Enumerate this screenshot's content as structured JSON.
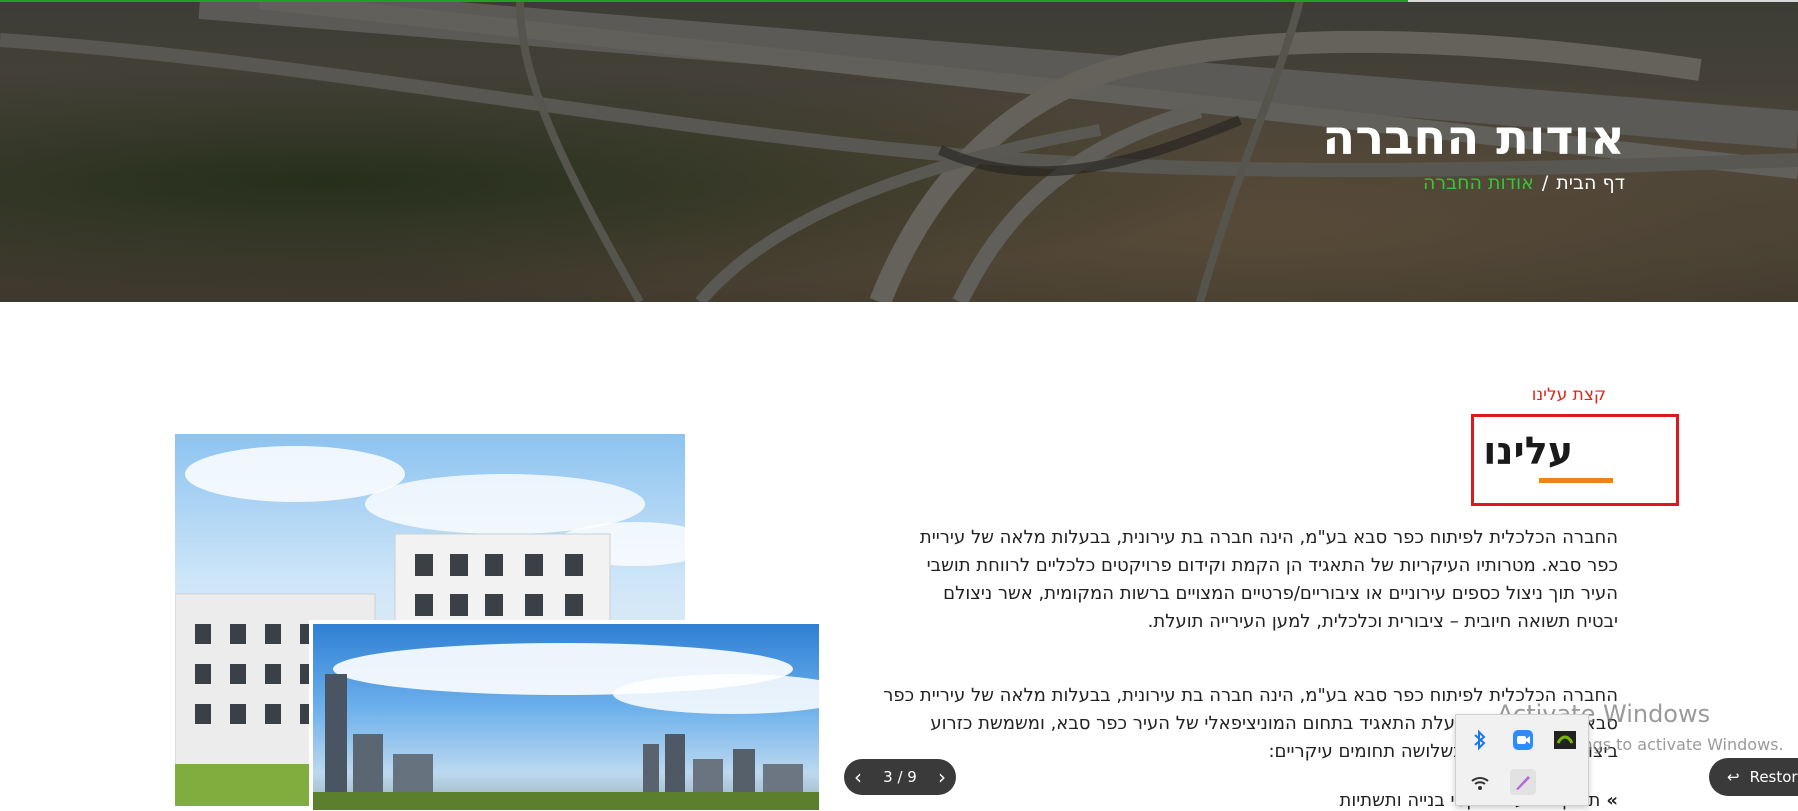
{
  "progress": {
    "fraction": 0.783,
    "color": "#1fa31f"
  },
  "hero": {
    "title": "אודות החברה",
    "breadcrumb": {
      "home": "דף הבית",
      "separator": "/",
      "current": "אודות החברה"
    }
  },
  "about": {
    "eyebrow": "קצת עלינו",
    "heading": "עלינו",
    "paragraph1": "החברה הכלכלית לפיתוח כפר סבא בע\"מ, הינה חברה בת עירונית, בבעלות מלאה של עיריית כפר סבא. מטרותיו העיקריות של התאגיד הן הקמת וקידום פרויקטים כלכליים לרווחת תושבי העיר תוך ניצול כספים עירוניים או ציבוריים/פרטיים המצויים ברשות המקומית, אשר ניצולם יבטיח תשואה חיובית – ציבורית וכלכלית, למען העירייה תועלת.",
    "paragraph2": "החברה הכלכלית לפיתוח כפר סבא בע\"מ, הינה חברה בת עירונית, בבעלות מלאה של עיריית כפר סבא. משנת 1991 פועלת התאגיד בתחום המוניציפאלי של העיר כפר סבא, ומשמשת כזרוע ביצועית של העירייה בשלושה תחומים עיקריים:",
    "bullet": "תכנון ביצוע פרויקטי בנייה ותשתיות"
  },
  "pager": {
    "label": "3 / 9",
    "prev": "‹",
    "next": "›"
  },
  "windows": {
    "activate_title": "Activate Windows",
    "activate_sub": "Go to Settings to activate Windows."
  },
  "tray": {
    "icons": [
      "bluetooth-icon",
      "zoom-icon",
      "nvidia-icon",
      "wifi-icon",
      "pen-icon"
    ]
  },
  "restore": {
    "label": "Restore"
  },
  "colors": {
    "accent_red": "#e0181e",
    "accent_orange": "#e8861c",
    "link_green": "#37c437"
  }
}
